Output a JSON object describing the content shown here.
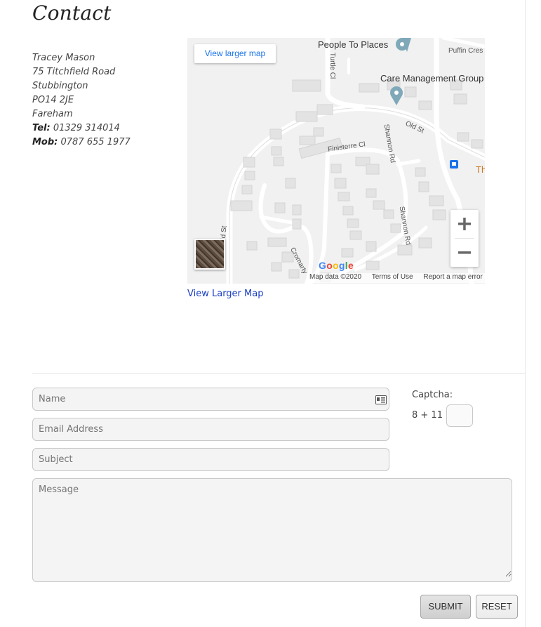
{
  "page": {
    "title": "Contact"
  },
  "address": {
    "name": "Tracey Mason",
    "street": "75 Titchfield Road",
    "area": "Stubbington",
    "postcode": "PO14 2JE",
    "town": "Fareham",
    "tel_label": "Tel:",
    "tel": "01329 314014",
    "mob_label": "Mob:",
    "mob": "0787 655 1977"
  },
  "map": {
    "view_larger_button": "View larger map",
    "labels": {
      "poi1": "People To Places",
      "poi2": "Care Management Group",
      "puffin": "Puffin Cres",
      "turtle": "Turtle Cl",
      "old_st_top": "Old St",
      "finisterre": "Finisterre Cl",
      "shannon1": "Shannon Rd",
      "shannon2": "Shannon Rd",
      "old_st_left": "Old St",
      "cromarty": "Cromarty",
      "th": "Th"
    },
    "google": [
      "G",
      "o",
      "o",
      "g",
      "l",
      "e"
    ],
    "google_colors": [
      "#4285F4",
      "#EA4335",
      "#FBBC05",
      "#4285F4",
      "#34A853",
      "#EA4335"
    ],
    "footer": {
      "data": "Map data ©2020",
      "terms": "Terms of Use",
      "report": "Report a map error"
    },
    "zoom_in": "+",
    "zoom_out": "−"
  },
  "view_larger_link": "View Larger Map",
  "form": {
    "name_placeholder": "Name",
    "email_placeholder": "Email Address",
    "subject_placeholder": "Subject",
    "message_placeholder": "Message",
    "captcha_label": "Captcha:",
    "captcha_question": "8 + 11 =",
    "submit": "SUBMIT",
    "reset": "RESET"
  }
}
